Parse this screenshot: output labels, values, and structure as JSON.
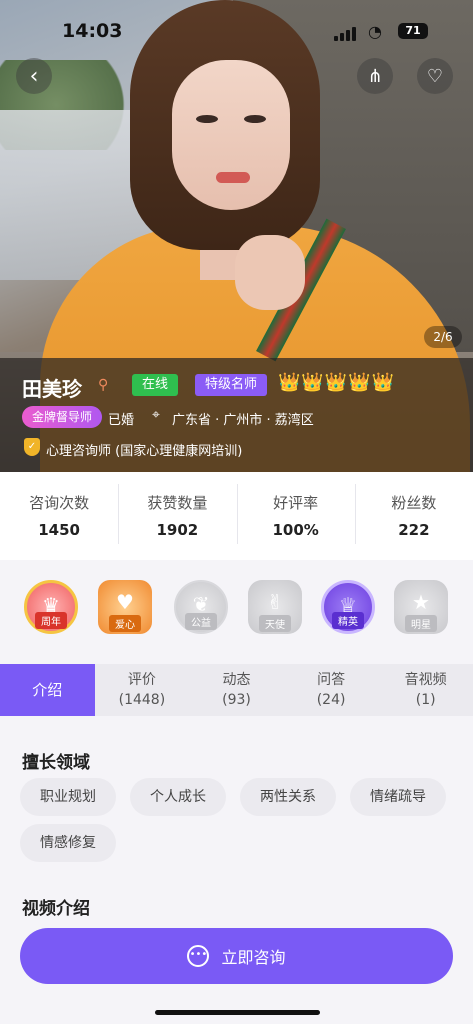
{
  "status_bar": {
    "time": "14:03",
    "battery": "71"
  },
  "hero": {
    "photo_counter": "2/6"
  },
  "profile": {
    "name": "田美珍",
    "online_tag": "在线",
    "level_tag": "特级名师",
    "crowns": "👑👑👑👑👑",
    "gold_tag": "金牌督导师",
    "marital_status": "已婚",
    "location": "广东省 · 广州市 · 荔湾区",
    "certification": "心理咨询师 (国家心理健康网培训)"
  },
  "stats": [
    {
      "label": "咨询次数",
      "value": "1450"
    },
    {
      "label": "获赞数量",
      "value": "1902"
    },
    {
      "label": "好评率",
      "value": "100%"
    },
    {
      "label": "粉丝数",
      "value": "222"
    }
  ],
  "badges": [
    "周年",
    "爱心",
    "公益",
    "天使",
    "精英",
    "明星"
  ],
  "tabs": [
    {
      "label": "介绍",
      "count": ""
    },
    {
      "label": "评价",
      "count": "(1448)"
    },
    {
      "label": "动态",
      "count": "(93)"
    },
    {
      "label": "问答",
      "count": "(24)"
    },
    {
      "label": "音视频",
      "count": "(1)"
    }
  ],
  "expertise": {
    "title": "擅长领域",
    "items": [
      "职业规划",
      "个人成长",
      "两性关系",
      "情绪疏导",
      "情感修复"
    ]
  },
  "video_intro": {
    "title": "视频介绍"
  },
  "cta": {
    "label": "立即咨询"
  },
  "colors": {
    "accent": "#7a5af5",
    "online": "#2fbf4f",
    "crown": "#f4c542"
  }
}
